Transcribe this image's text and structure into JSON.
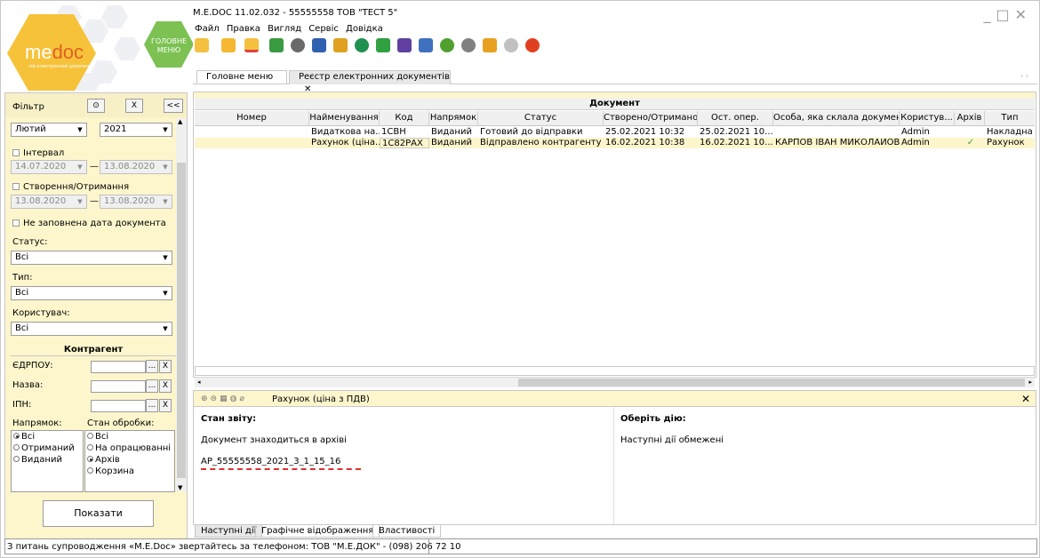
{
  "window": {
    "title": "M.E.DOC 11.02.032 - 55555558 ТОВ \"ТЕСТ 5\""
  },
  "logo": {
    "brand_left": "me",
    "brand_right": "doc",
    "subtitle": "ній електронний документ",
    "home_label_1": "ГОЛОВНЕ",
    "home_label_2": "МЕНЮ"
  },
  "menu": [
    "Файл",
    "Правка",
    "Вигляд",
    "Сервіс",
    "Довідка"
  ],
  "tabs": [
    {
      "label": "Головне меню"
    },
    {
      "label": "Реєстр електронних документів",
      "close": "✕"
    }
  ],
  "filter": {
    "title": "Фільтр",
    "clear_button": "X",
    "collapse_button": "<<",
    "month": "Лютий",
    "year": "2021",
    "interval_label": "Інтервал",
    "interval_from": "14.07.2020",
    "interval_to": "13.08.2020",
    "created_label": "Створення/Отримання",
    "created_from": "13.08.2020",
    "created_to": "13.08.2020",
    "dash": "—",
    "empty_date_label": "Не заповнена дата документа",
    "status_label": "Статус:",
    "status_value": "Всі",
    "type_label": "Тип:",
    "type_value": "Всі",
    "user_label": "Користувач:",
    "user_value": "Всі",
    "counterparty_title": "Контрагент",
    "edrpou_label": "ЄДРПОУ:",
    "name_label": "Назва:",
    "ipn_label": "ІПН:",
    "ellipsis": "...",
    "x": "X",
    "direction_label": "Напрямок:",
    "direction_options": [
      "Всі",
      "Отриманий",
      "Виданий"
    ],
    "processing_label": "Стан обробки:",
    "processing_options": [
      "Всі",
      "На опрацюванні",
      "Архів",
      "Корзина"
    ],
    "show_button": "Показати"
  },
  "grid": {
    "group_title": "Документ",
    "columns": [
      "Номер",
      "Найменування",
      "Код",
      "Напрямок",
      "Статус",
      "Створено/Отримано",
      "Ост. опер.",
      "Особа, яка склала документ",
      "Користув...",
      "Архів",
      "Тип"
    ],
    "rows": [
      [
        "",
        "Видаткова на...",
        "1СВН",
        "Виданий",
        "Готовий до відправки",
        "25.02.2021 10:32",
        "25.02.2021 10...",
        "",
        "Admin",
        "",
        "Накладна"
      ],
      [
        "",
        "Рахунок (ціна...",
        "1С82РАХ",
        "Виданий",
        "Відправлено контрагенту",
        "16.02.2021 10:38",
        "16.02.2021 10...",
        "КАРПОВ ІВАН МИКОЛАЙОВИЧ",
        "Admin",
        "✓",
        "Рахунок"
      ]
    ]
  },
  "details": {
    "title": "Рахунок (ціна з ПДВ)",
    "close": "✕",
    "report_state_label": "Стан звіту:",
    "report_state_text": "Документ знаходиться в архіві",
    "archive_name": "AP_55555558_2021_3_1_15_16",
    "choose_action_label": "Оберіть дію:",
    "actions_text": "Наступні дії обмежені"
  },
  "bottom_tabs": [
    "Наступні дії",
    "Графічне відображення",
    "Властивості"
  ],
  "status_bar": "З питань супроводження «M.E.Doc» звертайтесь за телефоном: ТОВ \"М.Е.ДОК\" - (098) 206 72 10",
  "colors": {
    "accent_yellow": "#fdf6cc",
    "logo_yellow": "#f6c23a",
    "home_green": "#7cc152",
    "underline_red": "#e03030"
  }
}
